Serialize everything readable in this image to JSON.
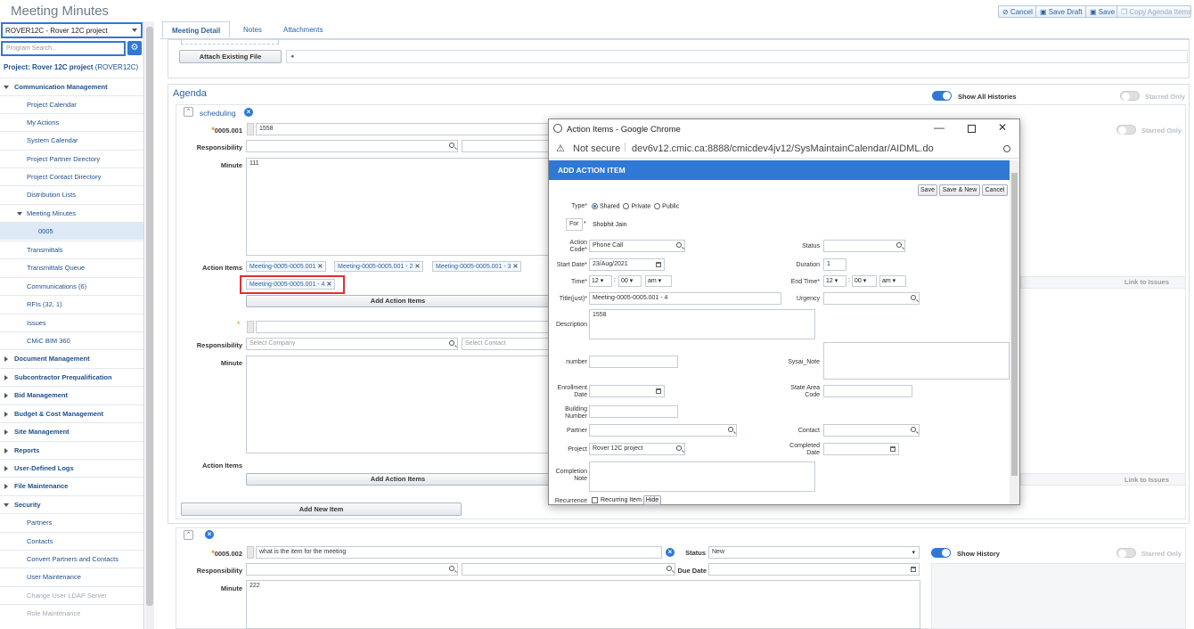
{
  "app_title": "Meeting Minutes",
  "toolbar": {
    "cancel": "Cancel",
    "save_draft": "Save Draft",
    "save": "Save",
    "copy_agenda": "Copy Agenda Items"
  },
  "project_selector": {
    "value": "ROVER12C - Rover 12C project"
  },
  "program_search": {
    "placeholder": "Program Search..."
  },
  "project_label": {
    "prefix": "Project: Rover 12C project",
    "code": "(ROVER12C)"
  },
  "sidebar": {
    "comm_mgmt": "Communication Management",
    "project_calendar": "Project Calendar",
    "my_actions": "My Actions",
    "system_calendar": "System Calendar",
    "partner_directory": "Project Partner Directory",
    "contact_directory": "Project Contact Directory",
    "distribution_lists": "Distribution Lists",
    "meeting_minutes": "Meeting Minutes",
    "mm_0005": "0005",
    "transmittals": "Transmittals",
    "transmittals_queue": "Transmittals Queue",
    "communications": "Communications (6)",
    "rfis": "RFIs (32, 1)",
    "issues": "Issues",
    "cmic_bim": "CMiC BIM 360",
    "document_mgmt": "Document Management",
    "subcontractor_prequal": "Subcontractor Prequalification",
    "bid_mgmt": "Bid Management",
    "budget_cost": "Budget & Cost Management",
    "site_mgmt": "Site Management",
    "reports": "Reports",
    "user_defined_logs": "User-Defined Logs",
    "file_maintenance": "File Maintenance",
    "security": "Security",
    "partners": "Partners",
    "contacts": "Contacts",
    "convert_partners": "Convert Partners and Contacts",
    "user_maintenance": "User Maintenance",
    "change_ldap": "Change User LDAP Server",
    "role_maintenance": "Role Maintenance"
  },
  "tabs": {
    "meeting_detail": "Meeting Detail",
    "notes": "Notes",
    "attachments": "Attachments"
  },
  "attach_existing_file": "Attach Existing File",
  "agenda": {
    "title": "Agenda",
    "show_all_histories": "Show All Histories",
    "starred_only": "Starred Only",
    "link_to_issues": "Link to Issues",
    "group_name": "scheduling",
    "item1": {
      "number": "0005.001",
      "title": "1558",
      "responsibility_label": "Responsibility",
      "minute_label": "Minute",
      "minute": "111",
      "action_items_label": "Action Items",
      "chips": [
        "Meeting-0005-0005.001",
        "Meeting-0005-0005.001 - 2",
        "Meeting-0005-0005.001 - 3",
        "Meeting-0005-0005.001 - 4"
      ],
      "add_action_items": "Add Action Items"
    },
    "item_new": {
      "responsibility_label": "Responsibility",
      "company_placeholder": "Select Company",
      "contact_placeholder": "Select Contact",
      "minute_label": "Minute",
      "action_items_label": "Action Items",
      "add_action_items": "Add Action Items"
    },
    "add_new_item": "Add New Item",
    "item2": {
      "number": "0005.002",
      "title": "what is the item for the meeting",
      "status_label": "Status",
      "status": "New",
      "show_history": "Show History",
      "starred_only": "Starred Only",
      "responsibility_label": "Responsibility",
      "due_date_label": "Due Date",
      "minute_label": "Minute",
      "minute": "222"
    }
  },
  "popup": {
    "window_title": "Action Items - Google Chrome",
    "not_secure": "Not secure",
    "url": "dev6v12.cmic.ca:8888/cmicdev4jv12/SysMaintainCalendar/AIDML.do",
    "header": "ADD ACTION ITEM",
    "buttons": {
      "save": "Save",
      "save_new": "Save & New",
      "cancel": "Cancel"
    },
    "type_label": "Type*",
    "type_options": [
      "Shared",
      "Private",
      "Public"
    ],
    "for_label": "For",
    "for_star": "*",
    "for_value": "Shobhit Jain",
    "action_code_label": "Action Code*",
    "action_code": "Phone Call",
    "status_label": "Status",
    "start_date_label": "Start Date*",
    "start_date": "23/Aug/2021",
    "duration_label": "Duration",
    "duration": "1",
    "time_label": "Time*",
    "time_h": "12",
    "time_m": "00",
    "time_ampm": "am",
    "end_time_label": "End Time*",
    "end_h": "12",
    "end_m": "00",
    "end_ampm": "am",
    "title_label": "Title(just)*",
    "title": "Meeting-0005-0005.001 - 4",
    "urgency_label": "Urgency",
    "description_label": "Description",
    "description": "1558",
    "number_label": "number",
    "sysai_note_label": "Sysai_Note",
    "enrollment_label": "Enrollment Date",
    "state_area_label": "State Area Code",
    "building_label": "Building Number",
    "partner_label": "Partner",
    "contact_label": "Contact",
    "project_label": "Project",
    "project": "Rover 12C project",
    "completed_label": "Completed Date",
    "completion_note_label": "Completion Note",
    "recurrence_label": "Recurrence",
    "recurring_item": "Recurring Item",
    "hide": "Hide"
  }
}
